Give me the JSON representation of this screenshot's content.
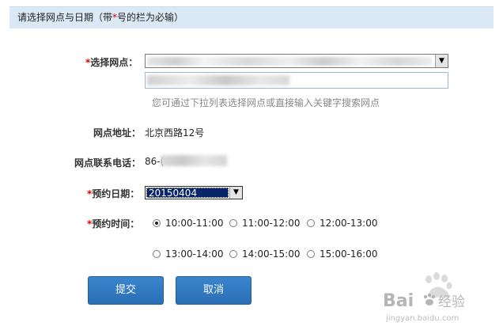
{
  "header": {
    "prefix": "请选择网点与日期（带",
    "star": "*",
    "suffix": "号的栏为必输）"
  },
  "form": {
    "branch": {
      "required_mark": "*",
      "label": "选择网点：",
      "hint": "您可通过下拉列表选择网点或直接输入关键字搜索网点"
    },
    "address": {
      "label": "网点地址：",
      "value": "北京西路12号"
    },
    "phone": {
      "label": "网点联系电话：",
      "value_prefix": "86-("
    },
    "date": {
      "required_mark": "*",
      "label": "预约日期：",
      "value": "20150404"
    },
    "time": {
      "required_mark": "*",
      "label": "预约时间：",
      "slots": [
        {
          "label": "10:00-11:00",
          "selected": true
        },
        {
          "label": "11:00-12:00",
          "selected": false
        },
        {
          "label": "12:00-13:00",
          "selected": false
        },
        {
          "label": "13:00-14:00",
          "selected": false
        },
        {
          "label": "14:00-15:00",
          "selected": false
        },
        {
          "label": "15:00-16:00",
          "selected": false
        }
      ]
    }
  },
  "buttons": {
    "submit": "提交",
    "cancel": "取消"
  },
  "watermark": {
    "brand": "Bai",
    "brand_end": "经验",
    "url": "jingyan.baidu.com"
  },
  "colors": {
    "header_bg": "#dbe9f7",
    "required": "#e00000",
    "button": "#2a6fb6",
    "date_highlight": "#0a246a"
  },
  "icons": [
    "chevron-down-icon",
    "radio-icon",
    "paw-icon"
  ]
}
